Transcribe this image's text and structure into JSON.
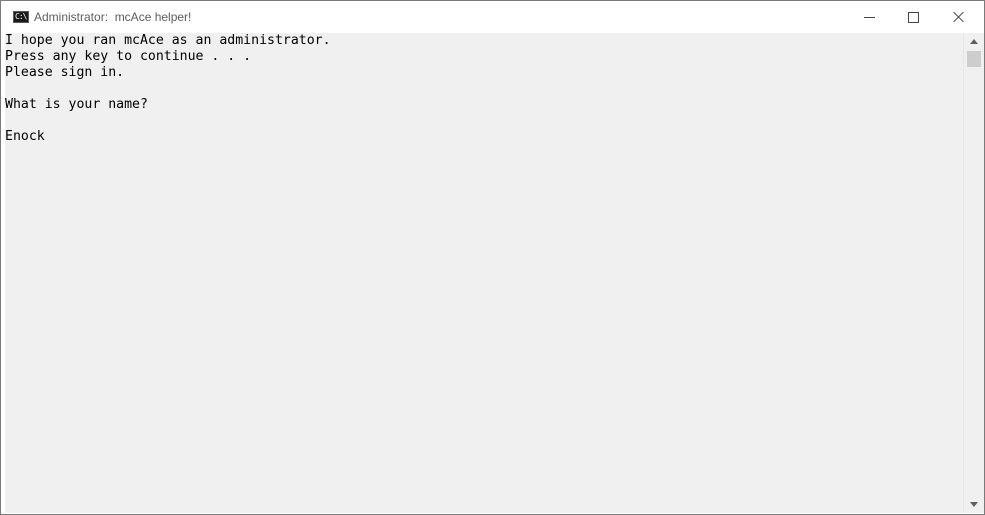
{
  "window": {
    "title": "Administrator:  mcAce helper!",
    "icon": "console-icon",
    "icon_text": "C:\\"
  },
  "controls": {
    "minimize": "minimize-icon",
    "maximize": "maximize-icon",
    "close": "close-icon"
  },
  "console": {
    "background": "#f0f0f0",
    "foreground": "#000000",
    "lines": [
      "I hope you ran mcAce as an administrator.",
      "Press any key to continue . . .",
      "Please sign in.",
      "",
      "What is your name?",
      "",
      "Enock"
    ]
  }
}
